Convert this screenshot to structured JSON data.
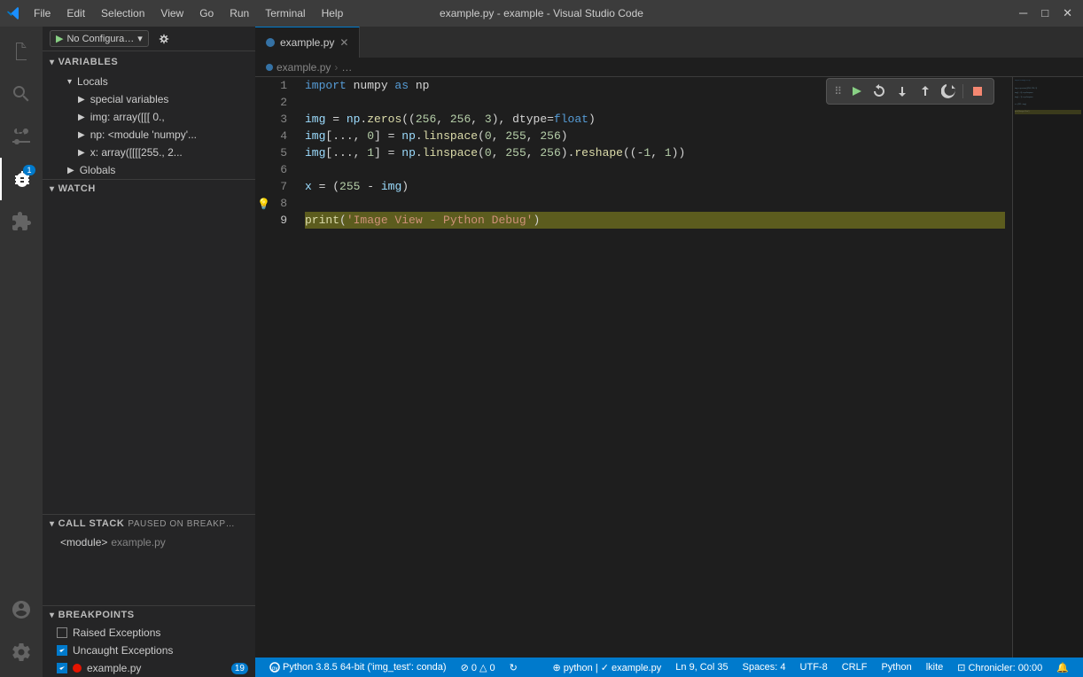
{
  "titleBar": {
    "title": "example.py - example - Visual Studio Code",
    "menuItems": [
      "File",
      "Edit",
      "Selection",
      "View",
      "Go",
      "Run",
      "Terminal",
      "Help"
    ],
    "windowControls": [
      "minimize",
      "maximize",
      "close"
    ]
  },
  "activityBar": {
    "icons": [
      {
        "name": "explore-icon",
        "symbol": "⎘",
        "active": false
      },
      {
        "name": "search-icon",
        "symbol": "🔍",
        "active": false
      },
      {
        "name": "source-control-icon",
        "symbol": "⎇",
        "active": false
      },
      {
        "name": "debug-icon",
        "symbol": "▷",
        "active": true,
        "badge": "1"
      },
      {
        "name": "extensions-icon",
        "symbol": "⊞",
        "active": false
      }
    ],
    "bottomIcons": [
      {
        "name": "account-icon",
        "symbol": "👤"
      },
      {
        "name": "settings-icon",
        "symbol": "⚙"
      }
    ]
  },
  "debugToolbar": {
    "configLabel": "No Configura…",
    "configIcon": "▶",
    "gearIcon": "⚙"
  },
  "sidebar": {
    "variablesSection": {
      "label": "VARIABLES",
      "localsLabel": "Locals",
      "items": [
        {
          "label": "special variables",
          "type": "group",
          "indent": 1
        },
        {
          "label": "img: array([[[  0.,",
          "type": "var",
          "indent": 1
        },
        {
          "label": "np: <module 'numpy'...",
          "type": "var",
          "indent": 1
        },
        {
          "label": "x: array([[[[255.,  2...",
          "type": "var",
          "indent": 1
        }
      ],
      "globalsLabel": "Globals"
    },
    "watchSection": {
      "label": "WATCH"
    },
    "callStackSection": {
      "label": "CALL STACK",
      "badge": "PAUSED ON BREAKP…",
      "frames": [
        {
          "module": "<module>",
          "file": "example.py"
        }
      ]
    },
    "breakpointsSection": {
      "label": "BREAKPOINTS",
      "items": [
        {
          "label": "Raised Exceptions",
          "checked": false,
          "hasDot": false
        },
        {
          "label": "Uncaught Exceptions",
          "checked": true,
          "hasDot": false
        },
        {
          "label": "example.py",
          "checked": true,
          "hasDot": true,
          "count": "19",
          "file": true
        }
      ]
    }
  },
  "editorTab": {
    "filename": "example.py",
    "language": "python"
  },
  "breadcrumb": {
    "items": [
      "example.py",
      "…"
    ]
  },
  "code": {
    "lines": [
      {
        "num": 1,
        "text": "import numpy as np",
        "tokens": [
          {
            "t": "kw",
            "v": "import"
          },
          {
            "t": "op",
            "v": " numpy "
          },
          {
            "t": "kw",
            "v": "as"
          },
          {
            "t": "op",
            "v": " np"
          }
        ]
      },
      {
        "num": 2,
        "text": "",
        "tokens": []
      },
      {
        "num": 3,
        "text": "img = np.zeros((256, 256, 3), dtype=float)",
        "tokens": [
          {
            "t": "var",
            "v": "img"
          },
          {
            "t": "op",
            "v": " = "
          },
          {
            "t": "var",
            "v": "np"
          },
          {
            "t": "op",
            "v": "."
          },
          {
            "t": "fn",
            "v": "zeros"
          },
          {
            "t": "punc",
            "v": "(("
          },
          {
            "t": "num",
            "v": "256"
          },
          {
            "t": "op",
            "v": ", "
          },
          {
            "t": "num",
            "v": "256"
          },
          {
            "t": "op",
            "v": ", "
          },
          {
            "t": "num",
            "v": "3"
          },
          {
            "t": "punc",
            "v": "), "
          },
          {
            "t": "op",
            "v": "dtype="
          },
          {
            "t": "kw",
            "v": "float"
          },
          {
            "t": "punc",
            "v": ")"
          }
        ]
      },
      {
        "num": 4,
        "text": "img[..., 0] = np.linspace(0, 255, 256)",
        "tokens": [
          {
            "t": "var",
            "v": "img"
          },
          {
            "t": "punc",
            "v": "["
          },
          {
            "t": "op",
            "v": "..., "
          },
          {
            "t": "num",
            "v": "0"
          },
          {
            "t": "punc",
            "v": "] = "
          },
          {
            "t": "var",
            "v": "np"
          },
          {
            "t": "op",
            "v": "."
          },
          {
            "t": "fn",
            "v": "linspace"
          },
          {
            "t": "punc",
            "v": "("
          },
          {
            "t": "num",
            "v": "0"
          },
          {
            "t": "op",
            "v": ", "
          },
          {
            "t": "num",
            "v": "255"
          },
          {
            "t": "op",
            "v": ", "
          },
          {
            "t": "num",
            "v": "256"
          },
          {
            "t": "punc",
            "v": ")"
          }
        ]
      },
      {
        "num": 5,
        "text": "img[..., 1] = np.linspace(0, 255, 256).reshape((-1, 1))",
        "tokens": [
          {
            "t": "var",
            "v": "img"
          },
          {
            "t": "punc",
            "v": "["
          },
          {
            "t": "op",
            "v": "..., "
          },
          {
            "t": "num",
            "v": "1"
          },
          {
            "t": "punc",
            "v": "] = "
          },
          {
            "t": "var",
            "v": "np"
          },
          {
            "t": "op",
            "v": "."
          },
          {
            "t": "fn",
            "v": "linspace"
          },
          {
            "t": "punc",
            "v": "("
          },
          {
            "t": "num",
            "v": "0"
          },
          {
            "t": "op",
            "v": ", "
          },
          {
            "t": "num",
            "v": "255"
          },
          {
            "t": "op",
            "v": ", "
          },
          {
            "t": "num",
            "v": "256"
          },
          {
            "t": "punc",
            "v": ")."
          },
          {
            "t": "fn",
            "v": "reshape"
          },
          {
            "t": "punc",
            "v": "(("
          },
          {
            "t": "op",
            "v": "-"
          },
          {
            "t": "num",
            "v": "1"
          },
          {
            "t": "op",
            "v": ", "
          },
          {
            "t": "num",
            "v": "1"
          },
          {
            "t": "punc",
            "v": "))"
          }
        ]
      },
      {
        "num": 6,
        "text": "",
        "tokens": []
      },
      {
        "num": 7,
        "text": "x = (255 - img)",
        "tokens": [
          {
            "t": "var",
            "v": "x"
          },
          {
            "t": "op",
            "v": " = ("
          },
          {
            "t": "num",
            "v": "255"
          },
          {
            "t": "op",
            "v": " - "
          },
          {
            "t": "var",
            "v": "img"
          },
          {
            "t": "punc",
            "v": ")"
          }
        ]
      },
      {
        "num": 8,
        "text": "",
        "lightbulb": true,
        "tokens": []
      },
      {
        "num": 9,
        "text": "print('Image View - Python Debug')",
        "active": true,
        "debugArrow": true,
        "tokens": [
          {
            "t": "fn",
            "v": "print"
          },
          {
            "t": "punc",
            "v": "("
          },
          {
            "t": "str",
            "v": "'Image View - Python Debug'"
          },
          {
            "t": "punc",
            "v": ")"
          }
        ]
      }
    ]
  },
  "floatToolbar": {
    "buttons": [
      "⠿",
      "▶",
      "↻",
      "⬇",
      "↪",
      "⬆",
      "⏹",
      "⟳"
    ]
  },
  "statusBar": {
    "left": [
      {
        "text": "Python 3.8.5 64-bit ('img_test': conda)",
        "icon": "python-icon"
      },
      {
        "text": "⊘ 0 △ 0"
      },
      {
        "text": "☁"
      }
    ],
    "right": [
      {
        "text": "Ln 9, Col 35"
      },
      {
        "text": "Spaces: 4"
      },
      {
        "text": "UTF-8"
      },
      {
        "text": "CRLF"
      },
      {
        "text": "Python"
      },
      {
        "text": "lkite"
      },
      {
        "text": "⊡ Chronicler: 00:00"
      },
      {
        "text": "🔔"
      }
    ]
  }
}
